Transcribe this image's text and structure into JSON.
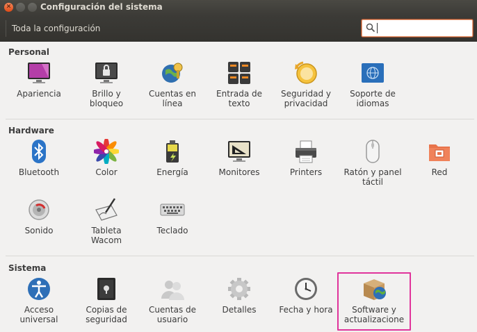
{
  "window": {
    "title": "Configuración del sistema"
  },
  "toolbar": {
    "all_settings": "Toda la configuración",
    "search_value": ""
  },
  "sections": [
    {
      "title": "Personal",
      "items": [
        {
          "label": "Apariencia",
          "icon": "appearance-icon"
        },
        {
          "label": "Brillo y\nbloqueo",
          "icon": "brightness-lock-icon"
        },
        {
          "label": "Cuentas en\nlínea",
          "icon": "online-accounts-icon"
        },
        {
          "label": "Entrada de\ntexto",
          "icon": "text-entry-icon"
        },
        {
          "label": "Seguridad y\nprivacidad",
          "icon": "security-privacy-icon"
        },
        {
          "label": "Soporte de\nidiomas",
          "icon": "language-support-icon"
        }
      ]
    },
    {
      "title": "Hardware",
      "items": [
        {
          "label": "Bluetooth",
          "icon": "bluetooth-icon"
        },
        {
          "label": "Color",
          "icon": "color-icon"
        },
        {
          "label": "Energía",
          "icon": "power-icon"
        },
        {
          "label": "Monitores",
          "icon": "displays-icon"
        },
        {
          "label": "Printers",
          "icon": "printer-icon"
        },
        {
          "label": "Ratón y panel\ntáctil",
          "icon": "mouse-touchpad-icon"
        },
        {
          "label": "Red",
          "icon": "network-icon"
        },
        {
          "label": "Sonido",
          "icon": "sound-icon"
        },
        {
          "label": "Tableta\nWacom",
          "icon": "wacom-tablet-icon"
        },
        {
          "label": "Teclado",
          "icon": "keyboard-icon"
        }
      ]
    },
    {
      "title": "Sistema",
      "items": [
        {
          "label": "Acceso\nuniversal",
          "icon": "universal-access-icon"
        },
        {
          "label": "Copias de\nseguridad",
          "icon": "backups-icon"
        },
        {
          "label": "Cuentas de\nusuario",
          "icon": "user-accounts-icon"
        },
        {
          "label": "Detalles",
          "icon": "details-icon"
        },
        {
          "label": "Fecha y hora",
          "icon": "date-time-icon"
        },
        {
          "label": "Software y\nactualizacione",
          "icon": "software-updates-icon"
        }
      ]
    }
  ],
  "colors": {
    "highlight": "#e0339b",
    "titlebar": "#3c3b37",
    "search_focus": "#e9a07a"
  }
}
